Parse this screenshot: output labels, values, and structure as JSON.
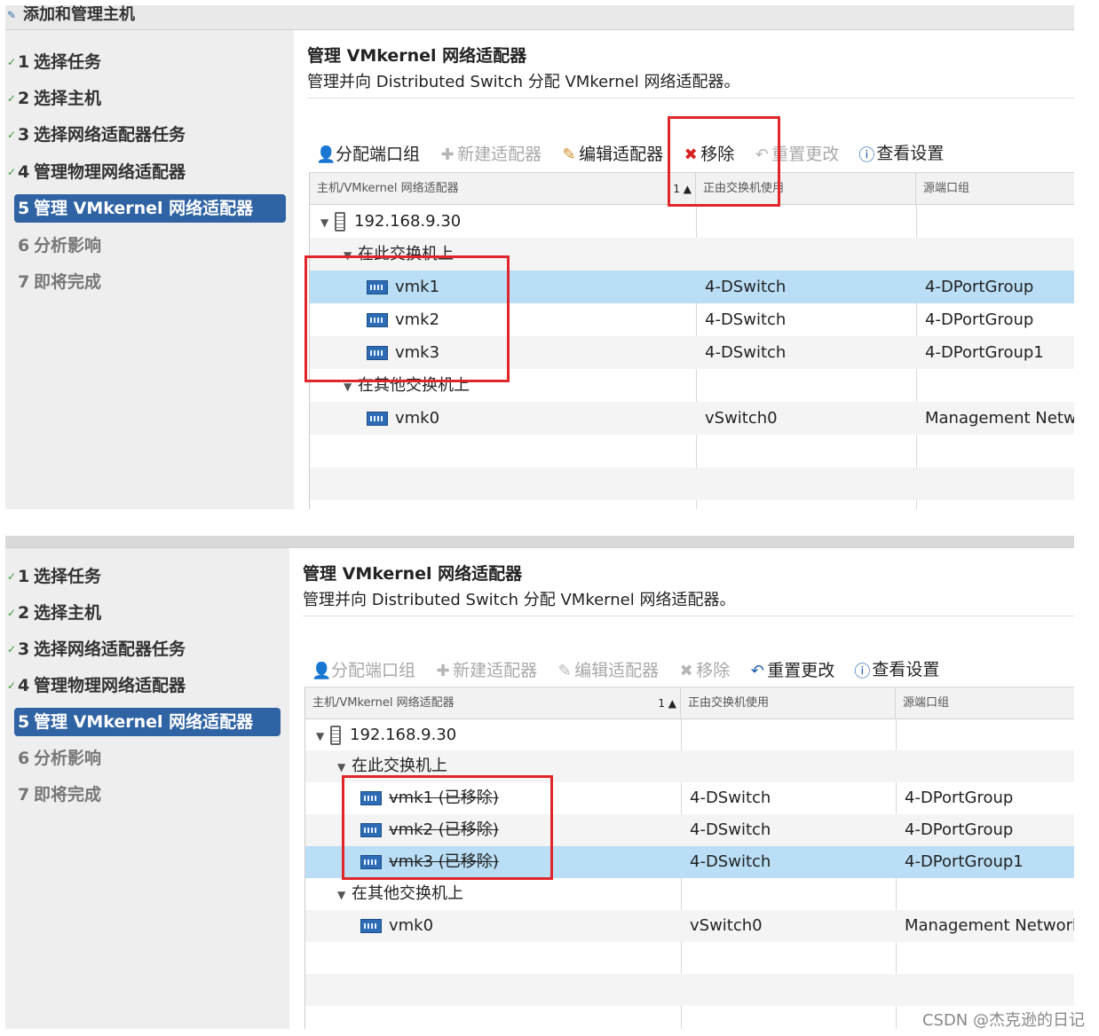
{
  "window": {
    "title": "添加和管理主机"
  },
  "steps": [
    {
      "num": "1",
      "label": "选择任务"
    },
    {
      "num": "2",
      "label": "选择主机"
    },
    {
      "num": "3",
      "label": "选择网络适配器任务"
    },
    {
      "num": "4",
      "label": "管理物理网络适配器"
    },
    {
      "num": "5",
      "label": "管理 VMkernel 网络适配器"
    },
    {
      "num": "6",
      "label": "分析影响"
    },
    {
      "num": "7",
      "label": "即将完成"
    }
  ],
  "page": {
    "title": "管理 VMkernel 网络适配器",
    "description": "管理并向 Distributed Switch 分配 VMkernel 网络适配器。"
  },
  "toolbar": {
    "assign_port_group": "分配端口组",
    "new_adapter": "新建适配器",
    "edit_adapter": "编辑适配器",
    "remove": "移除",
    "reset_changes": "重置更改",
    "view_settings": "查看设置"
  },
  "columns": {
    "adapter": "主机/VMkernel 网络适配器",
    "sort_indicator": "1 ▲",
    "in_use_by": "正由交换机使用",
    "source_port_group": "源端口组"
  },
  "grid1": {
    "host": "192.168.9.30",
    "group_this_switch": "在此交换机上",
    "group_other_switch": "在其他交换机上",
    "rows": [
      {
        "name": "vmk1",
        "switch": "4-DSwitch",
        "portgroup": "4-DPortGroup"
      },
      {
        "name": "vmk2",
        "switch": "4-DSwitch",
        "portgroup": "4-DPortGroup"
      },
      {
        "name": "vmk3",
        "switch": "4-DSwitch",
        "portgroup": "4-DPortGroup1"
      }
    ],
    "other": {
      "name": "vmk0",
      "switch": "vSwitch0",
      "portgroup": "Management Netwo"
    }
  },
  "grid2": {
    "host": "192.168.9.30",
    "group_this_switch": "在此交换机上",
    "group_other_switch": "在其他交换机上",
    "rows": [
      {
        "name": "vmk1 (已移除)",
        "switch": "4-DSwitch",
        "portgroup": "4-DPortGroup"
      },
      {
        "name": "vmk2 (已移除)",
        "switch": "4-DSwitch",
        "portgroup": "4-DPortGroup"
      },
      {
        "name": "vmk3 (已移除)",
        "switch": "4-DSwitch",
        "portgroup": "4-DPortGroup1"
      }
    ],
    "other": {
      "name": "vmk0",
      "switch": "vSwitch0",
      "portgroup": "Management Network"
    }
  },
  "watermark": "CSDN @杰克逊的日记",
  "colors": {
    "accent": "#2f63a3",
    "selection": "#b9def6",
    "highlight_box": "#e0262a"
  }
}
